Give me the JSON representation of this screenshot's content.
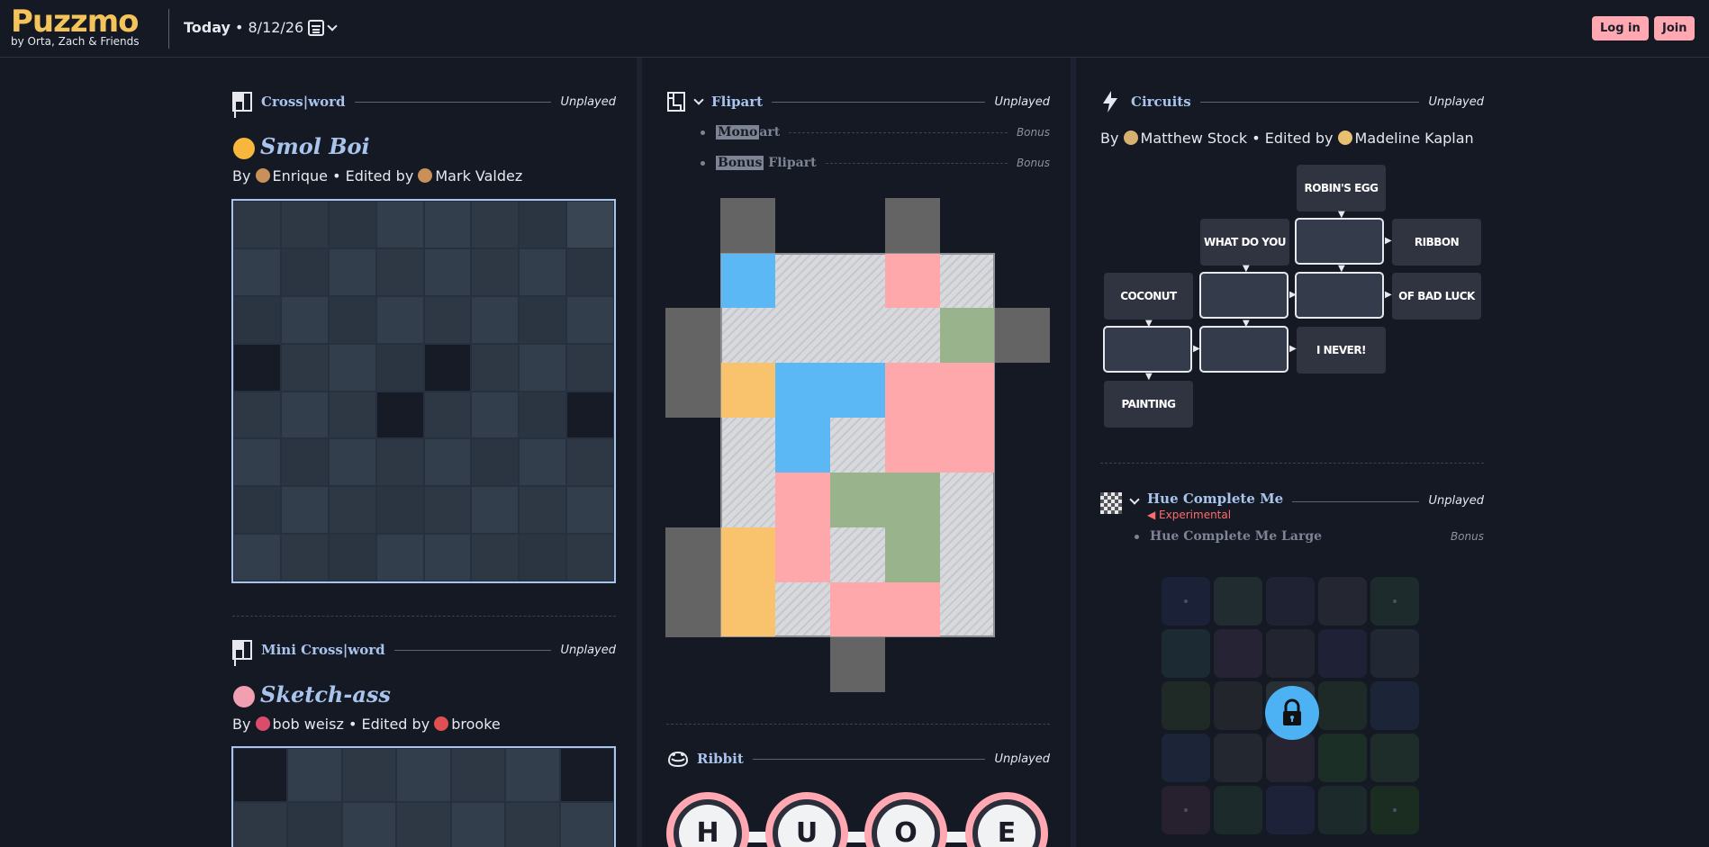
{
  "header": {
    "logo": "Puzzmo",
    "tagline": "by Orta, Zach & Friends",
    "today_label": "Today",
    "date": "• 8/12/26",
    "login": "Log in",
    "join": "Join"
  },
  "crossword": {
    "title": "Cross|word",
    "status": "Unplayed",
    "puzzle_title": "Smol Boi",
    "by": "By",
    "author": "Enrique",
    "edited_by": "• Edited by",
    "editor": "Mark Valdez",
    "grid_colors": [
      [
        "#2e3845",
        "#2e3845",
        "#2b3441",
        "#333e4c",
        "#333e4c",
        "#2f3946",
        "#2b3441",
        "#3a4554"
      ],
      [
        "#333e4c",
        "#2b3441",
        "#333e4c",
        "#2e3845",
        "#333e4c",
        "#2e3845",
        "#333e4c",
        "#2b3441"
      ],
      [
        "#2b3441",
        "#333e4c",
        "#2b3441",
        "#333e4c",
        "#2e3845",
        "#333e4c",
        "#2b3441",
        "#333e4c"
      ],
      [
        "#171b25",
        "#2e3845",
        "#333e4c",
        "#2b3441",
        "#171b25",
        "#2e3845",
        "#333e4c",
        "#2e3845"
      ],
      [
        "#2e3845",
        "#333e4c",
        "#2e3845",
        "#171b25",
        "#2e3845",
        "#333e4c",
        "#2b3441",
        "#171b25"
      ],
      [
        "#333e4c",
        "#2b3441",
        "#333e4c",
        "#2e3845",
        "#333e4c",
        "#2b3441",
        "#333e4c",
        "#2e3845"
      ],
      [
        "#2b3441",
        "#333e4c",
        "#2e3845",
        "#2b3441",
        "#2e3845",
        "#333e4c",
        "#2e3845",
        "#333e4c"
      ],
      [
        "#333e4c",
        "#2e3845",
        "#2b3441",
        "#333e4c",
        "#333e4c",
        "#2e3845",
        "#2b3441",
        "#2e3845"
      ]
    ]
  },
  "mini": {
    "title": "Mini Cross|word",
    "status": "Unplayed",
    "puzzle_title": "Sketch-ass",
    "by": "By",
    "author": "bob weisz",
    "edited_by": "• Edited by",
    "editor": "brooke"
  },
  "flipart": {
    "title": "Flipart",
    "status": "Unplayed",
    "bonus": [
      {
        "highlight": "Mono",
        "rest": "art",
        "tag": "Bonus"
      },
      {
        "highlight": "Bonus",
        "rest": "Flipart",
        "tag": "Bonus"
      }
    ]
  },
  "ribbit": {
    "title": "Ribbit",
    "status": "Unplayed",
    "letters": [
      "H",
      "U",
      "O",
      "E"
    ]
  },
  "circuits": {
    "title": "Circuits",
    "status": "Unplayed",
    "by": "By",
    "author": "Matthew Stock",
    "edited_by": "• Edited by",
    "editor": "Madeline Kaplan",
    "clues": [
      "ROBIN'S EGG",
      "WHAT DO YOU",
      "RIBBON",
      "COCONUT",
      "OF BAD LUCK",
      "I NEVER!",
      "PAINTING"
    ]
  },
  "hue": {
    "title": "Hue Complete Me",
    "badge": "Experimental",
    "status": "Unplayed",
    "bonus": "Hue Complete Me Large",
    "bonus_tag": "Bonus",
    "grid_colors": [
      [
        "#1b2136",
        "#202c30",
        "#1f2232",
        "#242731",
        "#1d2b2d"
      ],
      [
        "#1c2a33",
        "#262434",
        "#22252f",
        "#1f2236",
        "#212733"
      ],
      [
        "#1f2a26",
        "#22262c",
        "#283036",
        "#1d2a27",
        "#1c2438"
      ],
      [
        "#1c2438",
        "#23272f",
        "#262430",
        "#1c2f27",
        "#1f2d2a"
      ],
      [
        "#27212f",
        "#1d2a2c",
        "#1d2238",
        "#1d2a2c",
        "#1a2d20"
      ]
    ]
  },
  "colors": {
    "accent_blue": "#a9c4ec",
    "pink": "#ffa8b2",
    "logo_yellow": "#f4c45a",
    "bg": "#151924"
  }
}
